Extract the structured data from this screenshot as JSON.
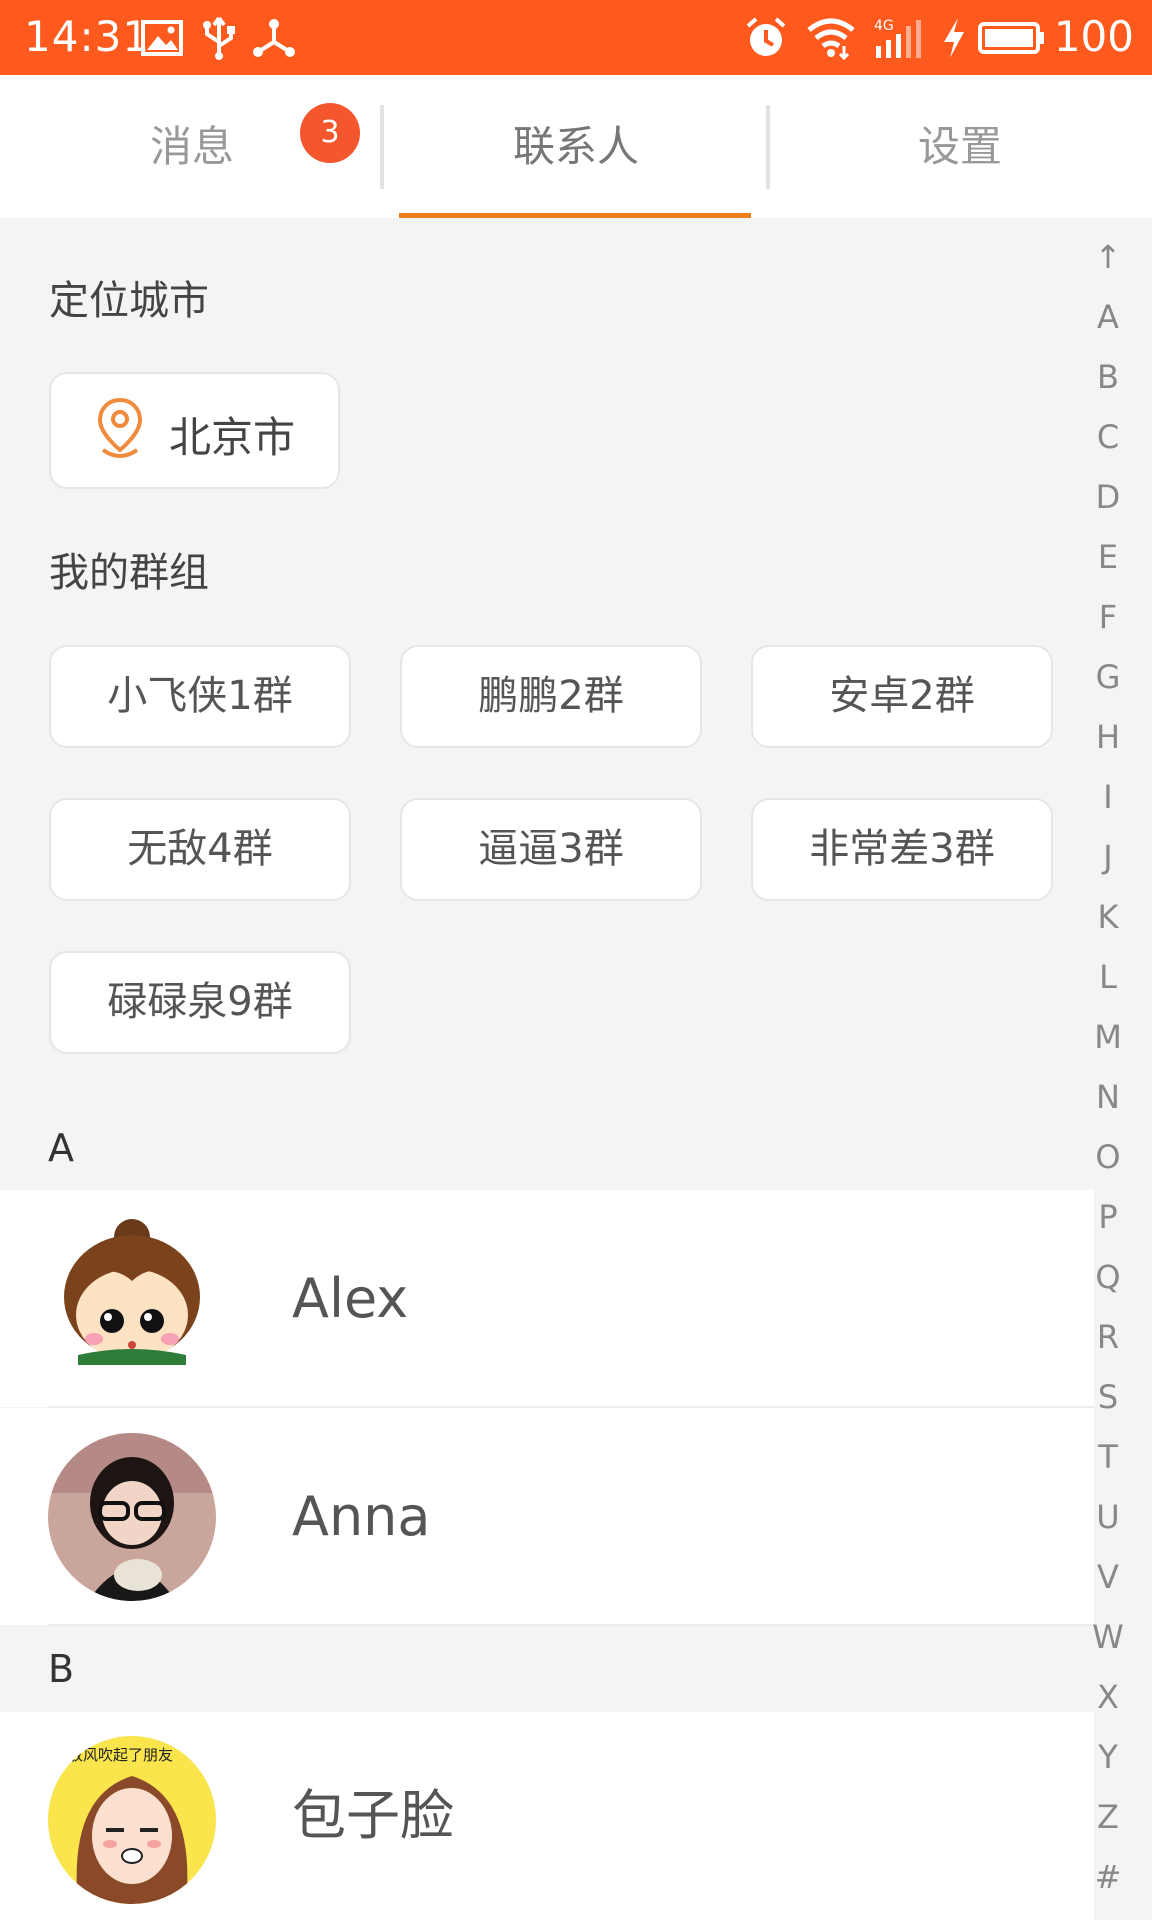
{
  "status_bar": {
    "time": "14:31",
    "battery": "100",
    "bg_color": "#ff5a1e",
    "icons": [
      "image-icon",
      "usb-icon",
      "share-icon",
      "alarm-icon",
      "wifi-icon",
      "signal-4g-icon",
      "charging-icon",
      "battery-icon"
    ]
  },
  "tabs": [
    {
      "label": "消息",
      "badge": "3"
    },
    {
      "label": "联系人",
      "active": true
    },
    {
      "label": "设置"
    }
  ],
  "accent_color": "#ee7f1c",
  "location": {
    "title": "定位城市",
    "city": "北京市",
    "icon": "location-pin-icon"
  },
  "groups": {
    "title": "我的群组",
    "items": [
      "小飞侠1群",
      "鹏鹏2群",
      "安卓2群",
      "无敌4群",
      "逼逼3群",
      "非常差3群",
      "碌碌泉9群"
    ]
  },
  "contacts": {
    "sections": [
      {
        "letter": "A",
        "items": [
          {
            "name": "Alex",
            "avatar": "cartoon-girl-avatar"
          },
          {
            "name": "Anna",
            "avatar": "photo-girl-avatar"
          }
        ]
      },
      {
        "letter": "B",
        "items": [
          {
            "name": "包子脸",
            "avatar": "cartoon-face-avatar"
          }
        ]
      }
    ]
  },
  "avatar_caption": "放风吹起了朋友",
  "index_bar": [
    "↑",
    "A",
    "B",
    "C",
    "D",
    "E",
    "F",
    "G",
    "H",
    "I",
    "J",
    "K",
    "L",
    "M",
    "N",
    "O",
    "P",
    "Q",
    "R",
    "S",
    "T",
    "U",
    "V",
    "W",
    "X",
    "Y",
    "Z",
    "#"
  ]
}
